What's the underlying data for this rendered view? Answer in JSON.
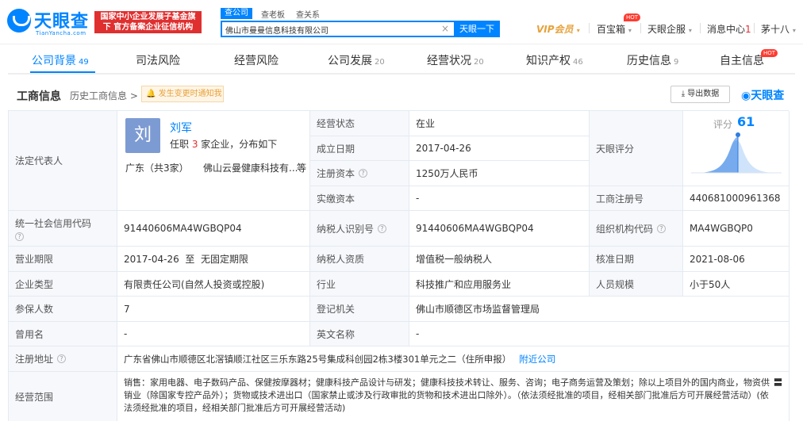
{
  "header": {
    "logo_text": "天眼查",
    "logo_sub": "TianYancha.com",
    "official_badge": "国家中小企业发展子基金旗下 官方备案企业征信机构",
    "search_tabs": [
      "查公司",
      "查老板",
      "查关系"
    ],
    "search_value": "佛山市曼曼信息科技有限公司",
    "search_button": "天眼一下",
    "nav": {
      "vip": "VIP会员",
      "baibao": "百宝箱",
      "enterprise": "天眼企服",
      "messages": "消息中心",
      "message_count": "1",
      "user": "茅十八",
      "hot": "HOT"
    }
  },
  "tabs": [
    {
      "label": "公司背景",
      "count": "49"
    },
    {
      "label": "司法风险",
      "count": ""
    },
    {
      "label": "经营风险",
      "count": ""
    },
    {
      "label": "公司发展",
      "count": "20"
    },
    {
      "label": "经营状况",
      "count": "20"
    },
    {
      "label": "知识产权",
      "count": "46"
    },
    {
      "label": "历史信息",
      "count": "9"
    },
    {
      "label": "自主信息",
      "count": ""
    }
  ],
  "tab_hot": "HOT",
  "section": {
    "title": "工商信息",
    "history": "历史工商信息 >",
    "notify": "发生变更时通知我",
    "export": "导出数据",
    "brand": "天眼查"
  },
  "legal": {
    "label": "法定代表人",
    "avatar_char": "刘",
    "name": "刘军",
    "sub_prefix": "任职 ",
    "sub_count": "3",
    "sub_suffix": " 家企业，分布如下",
    "region": "广东（共3家）",
    "company": "佛山云曼健康科技有...",
    "more": "等"
  },
  "score": {
    "label": "评分",
    "value": "61"
  },
  "fields": {
    "status_label": "经营状态",
    "status": "在业",
    "founded_label": "成立日期",
    "founded": "2017-04-26",
    "capital_label": "注册资本",
    "capital": "1250万人民币",
    "paid_label": "实缴资本",
    "paid": "-",
    "tianyan_score_label": "天眼评分",
    "reg_no_label": "工商注册号",
    "reg_no": "440681000961368",
    "credit_label": "统一社会信用代码",
    "credit": "91440606MA4WGBQP04",
    "taxid_label": "纳税人识别号",
    "taxid": "91440606MA4WGBQP04",
    "org_label": "组织机构代码",
    "org": "MA4WGBQP0",
    "term_label": "营业期限",
    "term": "2017-04-26  至  无固定期限",
    "taxpayer_label": "纳税人资质",
    "taxpayer": "增值税一般纳税人",
    "approve_label": "核准日期",
    "approve": "2021-08-06",
    "type_label": "企业类型",
    "type": "有限责任公司(自然人投资或控股)",
    "industry_label": "行业",
    "industry": "科技推广和应用服务业",
    "staff_label": "人员规模",
    "staff": "小于50人",
    "insured_label": "参保人数",
    "insured": "7",
    "authority_label": "登记机关",
    "authority": "佛山市顺德区市场监督管理局",
    "former_label": "曾用名",
    "former": "-",
    "english_label": "英文名称",
    "english": "-",
    "address_label": "注册地址",
    "address": "广东省佛山市顺德区北滘镇顺江社区三乐东路25号集成科创园2栋3楼301单元之二（住所申报）",
    "nearby": "附近公司",
    "scope_label": "经营范围",
    "scope": "销售：家用电器、电子数码产品、保健按摩器材；健康科技产品设计与研发；健康科技技术转让、服务、咨询；电子商务运营及策划；除以上项目外的国内商业，物资供销业（除国家专控产品外）；货物或技术进出口（国家禁止或涉及行政审批的货物和技术进出口除外）。（依法须经批准的项目，经相关部门批准后方可开展经营活动）(依法须经批准的项目，经相关部门批准后方可开展经营活动)"
  },
  "colors": {
    "brand": "#0084ff",
    "red": "#e02f2f",
    "gold": "#e6a23c"
  }
}
